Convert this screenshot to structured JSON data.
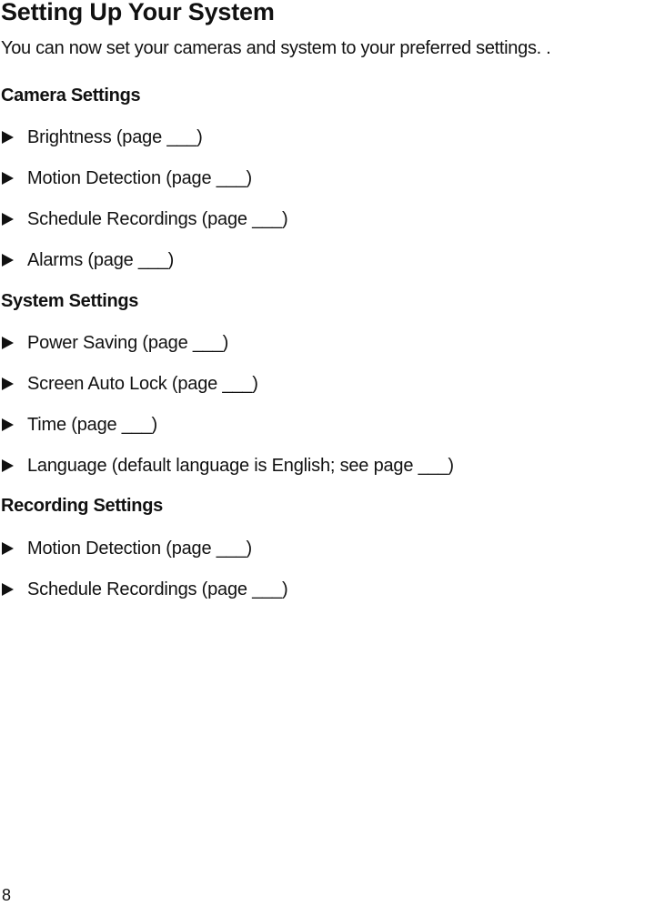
{
  "document": {
    "title": "Setting Up Your System",
    "intro": "You can now set your cameras and system to your preferred settings.  .",
    "page_number": "8"
  },
  "sections": [
    {
      "heading": "Camera Settings",
      "items": [
        "Brightness  (page ___)",
        "Motion Detection (page ___)",
        "Schedule Recordings (page ___)",
        "Alarms (page ___)"
      ]
    },
    {
      "heading": "System Settings",
      "items": [
        "Power Saving (page ___)",
        "Screen Auto Lock (page ___)",
        "Time (page ___)",
        "Language (default language is English; see page ___)"
      ]
    },
    {
      "heading": "Recording Settings",
      "items": [
        "Motion Detection (page ___)",
        "Schedule Recordings (page ___)"
      ]
    }
  ],
  "icons": {
    "bullet": "right-pointing-triangle-icon"
  }
}
